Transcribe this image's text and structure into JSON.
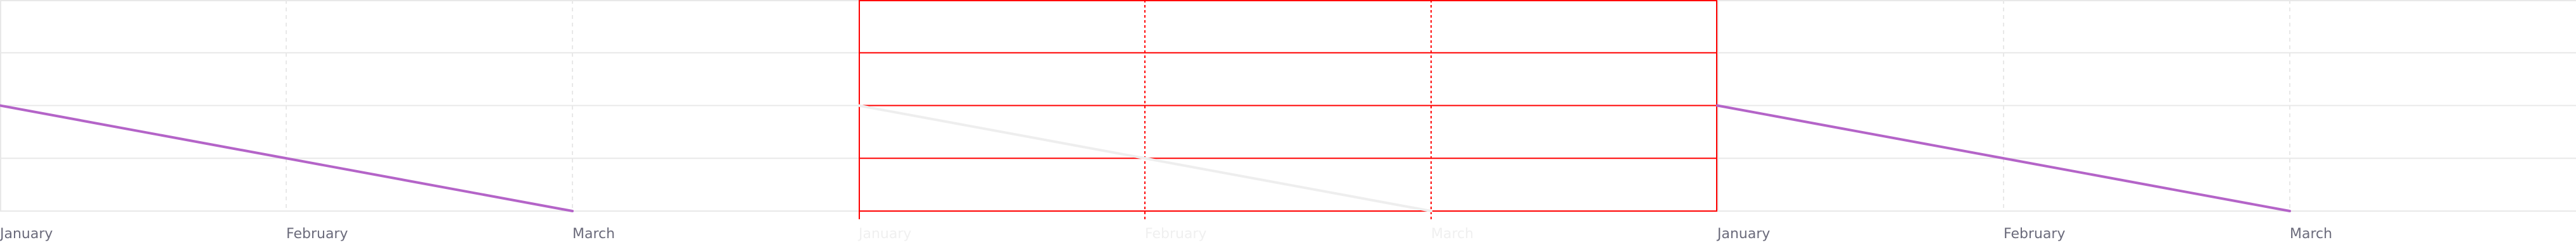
{
  "chart_data": [
    {
      "type": "line",
      "categories": [
        "January",
        "February",
        "March"
      ],
      "series": [
        {
          "values": [
            2,
            1,
            0
          ]
        }
      ],
      "ylim": [
        0,
        4
      ],
      "grid": true,
      "colors": {
        "line": "#b464c8",
        "grid": "#e8e8e8",
        "label": "#6b6b7b"
      }
    },
    {
      "type": "line",
      "categories": [
        "January",
        "February",
        "March"
      ],
      "series": [
        {
          "values": [
            2,
            1,
            0
          ]
        }
      ],
      "ylim": [
        0,
        4
      ],
      "grid": true,
      "faded": true,
      "colors": {
        "line": "#eeeeee",
        "grid": "#ff0000",
        "label": "#f0f0f0"
      }
    },
    {
      "type": "line",
      "categories": [
        "January",
        "February",
        "March"
      ],
      "series": [
        {
          "values": [
            2,
            1,
            0
          ]
        }
      ],
      "ylim": [
        0,
        4
      ],
      "grid": true,
      "colors": {
        "line": "#b464c8",
        "grid": "#e8e8e8",
        "label": "#6b6b7b"
      }
    }
  ]
}
